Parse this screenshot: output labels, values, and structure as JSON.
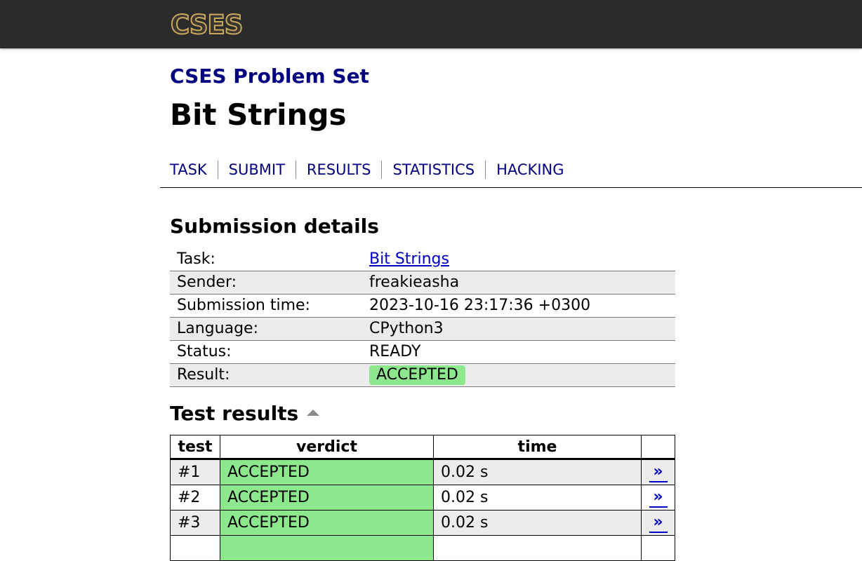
{
  "header": {
    "logo_text": "CSES",
    "brand_color": "#c9a85c"
  },
  "site_title": "CSES Problem Set",
  "page_title": "Bit Strings",
  "nav": {
    "tabs": [
      {
        "label": "TASK"
      },
      {
        "label": "SUBMIT"
      },
      {
        "label": "RESULTS"
      },
      {
        "label": "STATISTICS"
      },
      {
        "label": "HACKING"
      }
    ]
  },
  "submission": {
    "title": "Submission details",
    "rows": [
      {
        "key": "Task:",
        "value": "Bit Strings"
      },
      {
        "key": "Sender:",
        "value": "freakieasha"
      },
      {
        "key": "Submission time:",
        "value": "2023-10-16 23:17:36 +0300"
      },
      {
        "key": "Language:",
        "value": "CPython3"
      },
      {
        "key": "Status:",
        "value": "READY"
      },
      {
        "key": "Result:",
        "value": "ACCEPTED"
      }
    ]
  },
  "test_results": {
    "title": "Test results",
    "columns": {
      "test": "test",
      "verdict": "verdict",
      "time": "time"
    },
    "rows": [
      {
        "test": "#1",
        "verdict": "ACCEPTED",
        "time": "0.02 s"
      },
      {
        "test": "#2",
        "verdict": "ACCEPTED",
        "time": "0.02 s"
      },
      {
        "test": "#3",
        "verdict": "ACCEPTED",
        "time": "0.02 s"
      }
    ]
  },
  "colors": {
    "accepted": "#8de88d",
    "link": "#0000c0",
    "title": "#000080",
    "header_bg": "#2b2b2b"
  }
}
